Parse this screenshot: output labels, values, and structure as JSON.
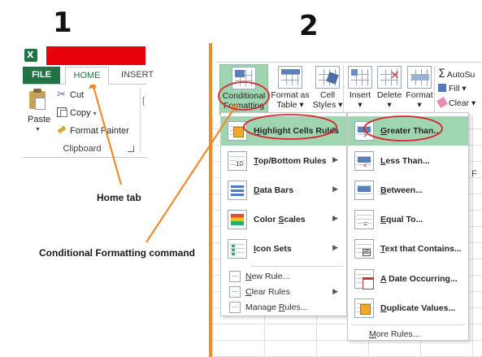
{
  "steps": [
    "1",
    "2"
  ],
  "panel1": {
    "tabs": [
      "FILE",
      "HOME",
      "INSERT"
    ],
    "paste_label": "Paste",
    "commands": [
      "Cut",
      "Copy",
      "Format Painter"
    ],
    "copy_caret": "▾",
    "group_label": "Clipboard",
    "partial_control": "["
  },
  "annotations": {
    "home_tab": "Home tab",
    "conditional_formatting": "Conditional Formatting command"
  },
  "ribbon": {
    "conditional_formatting": [
      "Conditional",
      "Formatting ▾"
    ],
    "format_as_table": [
      "Format as",
      "Table ▾"
    ],
    "cell_styles": [
      "Cell",
      "Styles ▾"
    ],
    "insert": [
      "Insert",
      "▾"
    ],
    "delete": [
      "Delete",
      "▾"
    ],
    "format": [
      "Format",
      "▾"
    ],
    "autosum": "AutoSu",
    "fill": "Fill ▾",
    "clear": "Clear ▾"
  },
  "cf_menu": {
    "items": [
      {
        "label": "Highlight Cells Rules",
        "key": "H",
        "has_submenu": true,
        "highlighted": true
      },
      {
        "label": "Top/Bottom Rules",
        "key": "T",
        "has_submenu": true,
        "highlighted": false
      },
      {
        "label": "Data Bars",
        "key": "D",
        "has_submenu": true,
        "highlighted": false
      },
      {
        "label": "Color Scales",
        "key": "S",
        "has_submenu": true,
        "highlighted": false
      },
      {
        "label": "Icon Sets",
        "key": "I",
        "has_submenu": true,
        "highlighted": false
      }
    ],
    "small_items": [
      {
        "label": "New Rule...",
        "key": "N",
        "has_submenu": false
      },
      {
        "label": "Clear Rules",
        "key": "C",
        "has_submenu": true
      },
      {
        "label": "Manage Rules...",
        "key": "R",
        "has_submenu": false
      }
    ],
    "icon_label_top_bottom": "10"
  },
  "highlight_submenu": {
    "items": [
      {
        "label": "Greater Than...",
        "key": "G",
        "highlighted": true
      },
      {
        "label": "Less Than...",
        "key": "L",
        "highlighted": false
      },
      {
        "label": "Between...",
        "key": "B",
        "highlighted": false
      },
      {
        "label": "Equal To...",
        "key": "E",
        "highlighted": false
      },
      {
        "label": "Text that Contains...",
        "key": "T",
        "highlighted": false
      },
      {
        "label": "A Date Occurring...",
        "key": "A",
        "highlighted": false
      },
      {
        "label": "Duplicate Values...",
        "key": "D",
        "highlighted": false
      }
    ],
    "more_rules": "More Rules...",
    "more_rules_key": "M",
    "icon_glyphs": [
      ">",
      "<",
      "",
      "=",
      "ab",
      "",
      ""
    ]
  },
  "sheet": {
    "column_fragment": "F"
  },
  "colors": {
    "excel_green": "#217346",
    "title_bar_red": "#e8000b",
    "highlight_green": "#9fd5b0",
    "arrow_orange": "#ef8a2e",
    "circle_red": "#d9262e"
  }
}
